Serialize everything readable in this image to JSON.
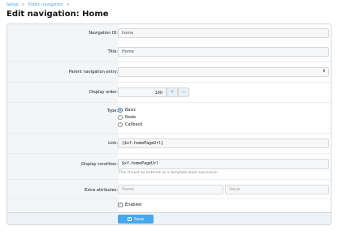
{
  "breadcrumb": {
    "items": [
      "Setup",
      "Public navigation"
    ],
    "separator": ">"
  },
  "page_title": "Edit navigation: Home",
  "form": {
    "navigation_id": {
      "label": "Navigation ID:",
      "value": "home"
    },
    "title": {
      "label": "Title:",
      "value": "Home"
    },
    "parent_entry": {
      "label": "Parent navigation entry:",
      "value": "",
      "arrow": "⬍"
    },
    "display_order": {
      "label": "Display order:",
      "value": "100",
      "plus": "+",
      "minus": "−"
    },
    "type": {
      "label": "Type:",
      "options": [
        "Basic",
        "Node",
        "Callback"
      ],
      "selected": "Basic"
    },
    "link": {
      "label": "Link:",
      "value": "{$xf.homePageUrl}"
    },
    "display_condition": {
      "label": "Display condition:",
      "value": "$xf.homePageUrl",
      "hint": "This should be entered as a template-style expression."
    },
    "extra_attributes": {
      "label": "Extra attributes:",
      "name_placeholder": "Name",
      "value_placeholder": "Value"
    },
    "enabled": {
      "label": "Enabled",
      "checked": true,
      "check_mark": "✓"
    }
  },
  "footer": {
    "save_label": "Save"
  },
  "colors": {
    "accent": "#47a7eb",
    "panel_left": "#f3f5f7",
    "footer_bg": "#edf2f7"
  }
}
